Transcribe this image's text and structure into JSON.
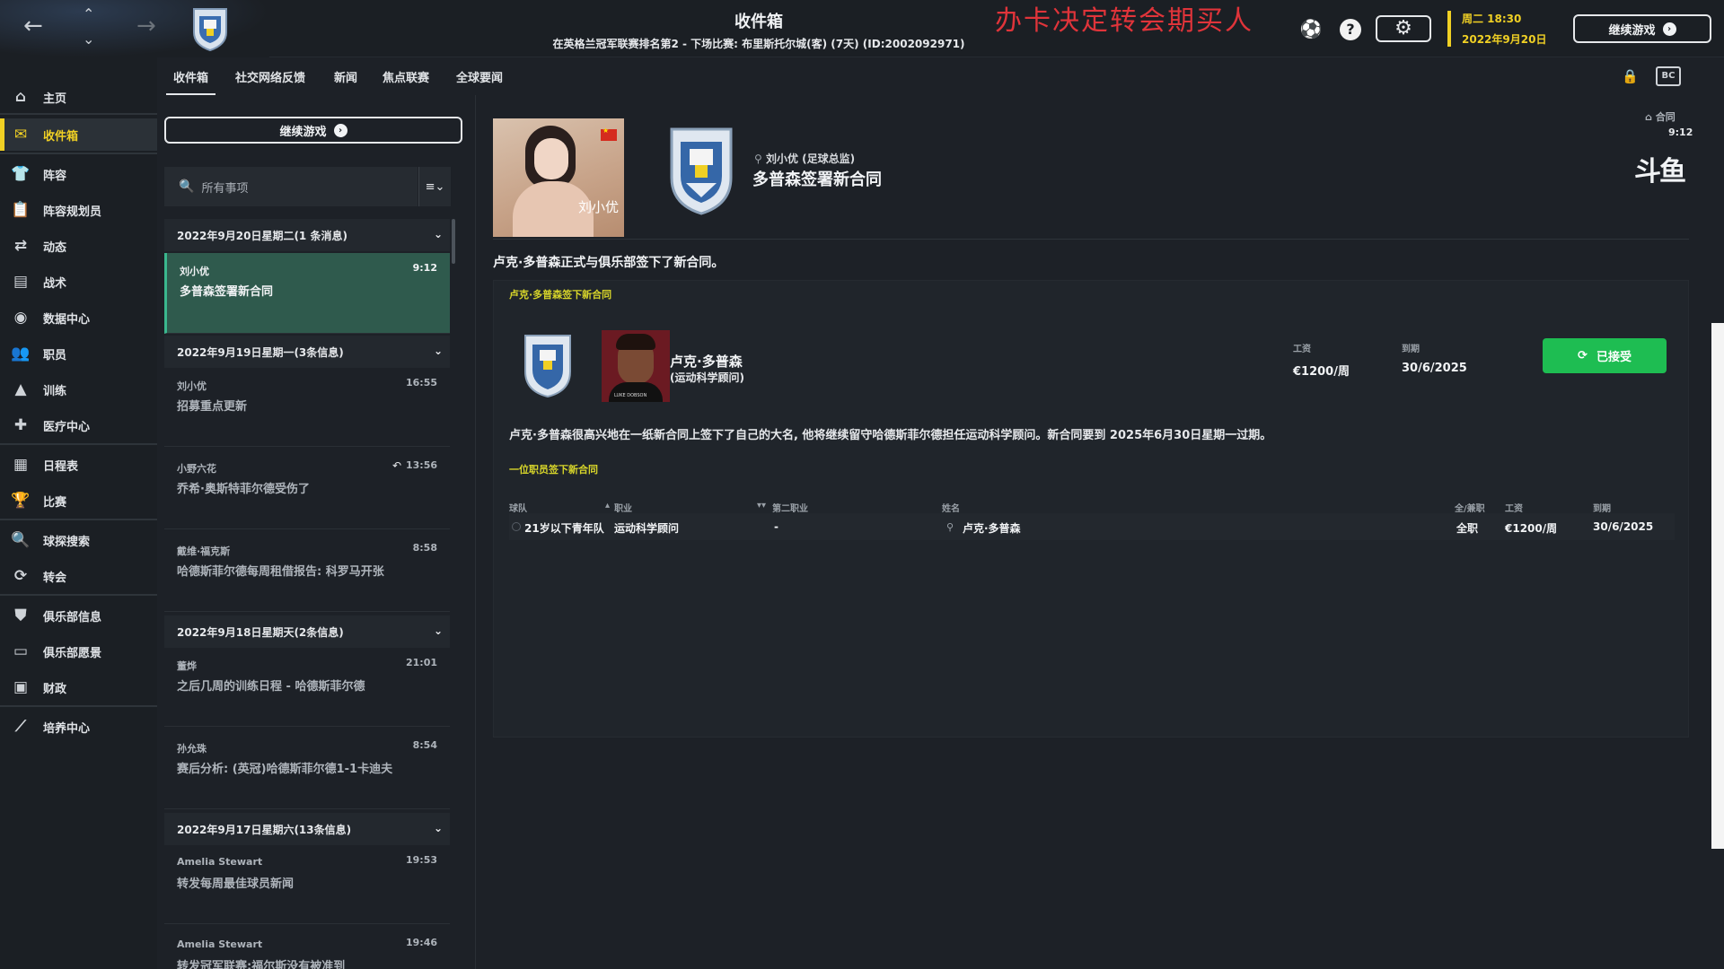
{
  "topbar": {
    "title": "收件箱",
    "subtitle": "在英格兰冠军联赛排名第2 - 下场比赛: 布里斯托尔城(客) (7天) (ID:2002092971)",
    "overlay_text": "办卡决定转会期买人",
    "date_line1": "周二 18:30",
    "date_line2": "2022年9月20日",
    "continue_label": "继续游戏"
  },
  "sidebar": {
    "items": [
      {
        "label": "主页",
        "icon": "home-icon",
        "glyph": "⌂"
      },
      {
        "label": "收件箱",
        "icon": "inbox-icon",
        "glyph": "✉"
      },
      {
        "label": "阵容",
        "icon": "shirt-icon",
        "glyph": "👕"
      },
      {
        "label": "阵容规划员",
        "icon": "clipboard-icon",
        "glyph": "📋"
      },
      {
        "label": "动态",
        "icon": "dynamics-icon",
        "glyph": "⇄"
      },
      {
        "label": "战术",
        "icon": "tactics-icon",
        "glyph": "▤"
      },
      {
        "label": "数据中心",
        "icon": "data-icon",
        "glyph": "◉"
      },
      {
        "label": "职员",
        "icon": "staff-icon",
        "glyph": "👥"
      },
      {
        "label": "训练",
        "icon": "training-icon",
        "glyph": "▲"
      },
      {
        "label": "医疗中心",
        "icon": "medical-icon",
        "glyph": "✚"
      },
      {
        "label": "日程表",
        "icon": "calendar-icon",
        "glyph": "▦"
      },
      {
        "label": "比赛",
        "icon": "trophy-icon",
        "glyph": "🏆"
      },
      {
        "label": "球探搜索",
        "icon": "scout-icon",
        "glyph": "🔍"
      },
      {
        "label": "转会",
        "icon": "transfer-icon",
        "glyph": "⟳"
      },
      {
        "label": "俱乐部信息",
        "icon": "shield-icon",
        "glyph": "⛊"
      },
      {
        "label": "俱乐部愿景",
        "icon": "vision-icon",
        "glyph": "▭"
      },
      {
        "label": "财政",
        "icon": "finance-icon",
        "glyph": "▣"
      },
      {
        "label": "培养中心",
        "icon": "development-icon",
        "glyph": "⟋"
      }
    ]
  },
  "tabs": {
    "items": [
      "收件箱",
      "社交网络反馈",
      "新闻",
      "焦点联赛",
      "全球要闻"
    ]
  },
  "inbox": {
    "continue_label": "继续游戏",
    "search_placeholder": "所有事项",
    "groups": [
      {
        "header": "2022年9月20日星期二(1 条消息)"
      },
      {
        "header": "2022年9月19日星期一(3条信息)"
      },
      {
        "header": "2022年9月18日星期天(2条信息)"
      },
      {
        "header": "2022年9月17日星期六(13条信息)"
      }
    ],
    "messages": [
      {
        "from": "刘小优",
        "time": "9:12",
        "subject": "多普森签署新合同"
      },
      {
        "from": "刘小优",
        "time": "16:55",
        "subject": "招募重点更新"
      },
      {
        "from": "小野六花",
        "time": "13:56",
        "subject": "乔希·奥斯特菲尔德受伤了"
      },
      {
        "from": "戴维·福克斯",
        "time": "8:58",
        "subject": "哈德斯菲尔德每周租借报告: 科罗马开张"
      },
      {
        "from": "董烨",
        "time": "21:01",
        "subject": "之后几周的训练日程 - 哈德斯菲尔德"
      },
      {
        "from": "孙允珠",
        "time": "8:54",
        "subject": "赛后分析: (英冠)哈德斯菲尔德1-1卡迪夫"
      },
      {
        "from": "Amelia Stewart",
        "time": "19:53",
        "subject": "转发每周最佳球员新闻"
      },
      {
        "from": "Amelia Stewart",
        "time": "19:46",
        "subject": "转发冠军联赛:福尔斯没有被准到"
      }
    ]
  },
  "message": {
    "photo_caption": "刘小优",
    "sender": "刘小优 (足球总监)",
    "headline": "多普森签署新合同",
    "tag": "合同",
    "tag_time": "9:12",
    "watermark": "斗鱼",
    "summary": "卢克·多普森正式与俱乐部签下了新合同。",
    "card_title": "卢克·多普森签下新合同",
    "staff_name": "卢克·多普森",
    "staff_role": "(运动科学顾问)",
    "staff_photo_caption": "LUKE DOBSON",
    "wage_label": "工资",
    "wage_value": "€1200/周",
    "expiry_label": "到期",
    "expiry_value": "30/6/2025",
    "accepted_label": "已接受",
    "paragraph": "卢克·多普森很高兴地在一纸新合同上签下了自己的大名, 他将继续留守哈德斯菲尔德担任运动科学顾问。新合同要到 2025年6月30日星期一过期。",
    "table_title": "一位职员签下新合同",
    "table_headers": {
      "team": "球队",
      "role": "职业",
      "second_role": "第二职业",
      "name": "姓名",
      "type": "全/兼职",
      "wage": "工资",
      "expiry": "到期"
    },
    "table_row": {
      "team": "21岁以下青年队",
      "role": "运动科学顾问",
      "second_role": "-",
      "name": "卢克·多普森",
      "type": "全职",
      "wage": "€1200/周",
      "expiry": "30/6/2025"
    }
  },
  "colors": {
    "accent_yellow": "#f0d024",
    "selected_green": "#2f5a4d",
    "accepted_green": "#1ebd52",
    "label_yellow": "#d8d62a"
  }
}
